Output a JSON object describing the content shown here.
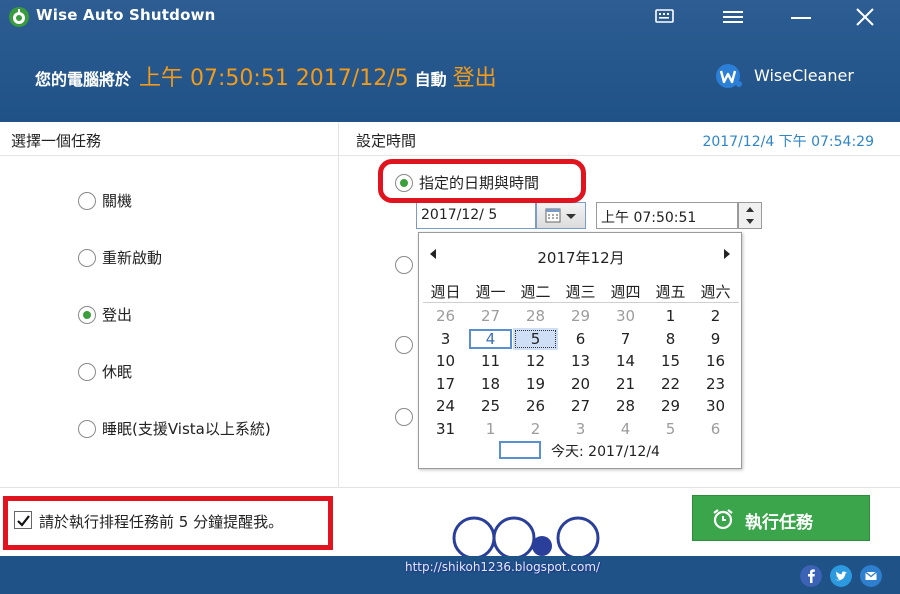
{
  "window": {
    "title": "Wise Auto Shutdown"
  },
  "header": {
    "schedule_prefix": "您的電腦將於",
    "schedule_time": "上午 07:50:51 2017/12/5",
    "schedule_suffix": "自動",
    "schedule_action": "登出",
    "brand": "WiseCleaner"
  },
  "tasks": {
    "heading": "選擇一個任務",
    "options": [
      {
        "label": "關機",
        "checked": false
      },
      {
        "label": "重新啟動",
        "checked": false
      },
      {
        "label": "登出",
        "checked": true
      },
      {
        "label": "休眠",
        "checked": false
      },
      {
        "label": "睡眠(支援Vista以上系統)",
        "checked": false
      }
    ]
  },
  "timing": {
    "heading": "設定時間",
    "current_datetime": "2017/12/4 下午 07:54:29",
    "mode_label": "指定的日期與時間",
    "date_value": "2017/12/ 5",
    "time_value": "上午 07:50:51"
  },
  "calendar": {
    "month_label": "2017年12月",
    "weekdays": [
      "週日",
      "週一",
      "週二",
      "週三",
      "週四",
      "週五",
      "週六"
    ],
    "weeks": [
      [
        {
          "d": "26",
          "o": true
        },
        {
          "d": "27",
          "o": true
        },
        {
          "d": "28",
          "o": true
        },
        {
          "d": "29",
          "o": true
        },
        {
          "d": "30",
          "o": true
        },
        {
          "d": "1"
        },
        {
          "d": "2"
        }
      ],
      [
        {
          "d": "3"
        },
        {
          "d": "4",
          "today": true
        },
        {
          "d": "5",
          "sel": true
        },
        {
          "d": "6"
        },
        {
          "d": "7"
        },
        {
          "d": "8"
        },
        {
          "d": "9"
        }
      ],
      [
        {
          "d": "10"
        },
        {
          "d": "11"
        },
        {
          "d": "12"
        },
        {
          "d": "13"
        },
        {
          "d": "14"
        },
        {
          "d": "15"
        },
        {
          "d": "16"
        }
      ],
      [
        {
          "d": "17"
        },
        {
          "d": "18"
        },
        {
          "d": "19"
        },
        {
          "d": "20"
        },
        {
          "d": "21"
        },
        {
          "d": "22"
        },
        {
          "d": "23"
        }
      ],
      [
        {
          "d": "24"
        },
        {
          "d": "25"
        },
        {
          "d": "26"
        },
        {
          "d": "27"
        },
        {
          "d": "28"
        },
        {
          "d": "29"
        },
        {
          "d": "30"
        }
      ],
      [
        {
          "d": "31"
        },
        {
          "d": "1",
          "o": true
        },
        {
          "d": "2",
          "o": true
        },
        {
          "d": "3",
          "o": true
        },
        {
          "d": "4",
          "o": true
        },
        {
          "d": "5",
          "o": true
        },
        {
          "d": "6",
          "o": true
        }
      ]
    ],
    "today_label": "今天: 2017/12/4"
  },
  "reminder": {
    "checked": true,
    "label": "請於執行排程任務前 5 分鐘提醒我。"
  },
  "actions": {
    "run_label": "執行任務"
  },
  "watermark": {
    "link": "http://shikoh1236.blogspot.com/"
  },
  "colors": {
    "header_bg": "#1f5287",
    "accent_orange": "#f39a18",
    "run_green": "#3aa54a",
    "highlight_red": "#e0141f",
    "clock_blue": "#2f86c8"
  },
  "icons": {
    "feedback": "chat-icon",
    "menu": "menu-icon",
    "minimize": "minimize-icon",
    "close": "close-icon",
    "alarm": "alarm-clock-icon",
    "social": [
      "facebook-icon",
      "twitter-icon",
      "email-icon"
    ]
  }
}
